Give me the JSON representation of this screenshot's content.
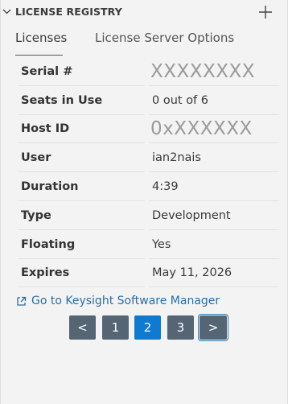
{
  "header": {
    "title": "LICENSE REGISTRY"
  },
  "tabs": [
    {
      "label": "Licenses",
      "active": true
    },
    {
      "label": "License Server Options",
      "active": false
    }
  ],
  "license": {
    "rows": [
      {
        "key": "Serial #",
        "value": "XXXXXXXX"
      },
      {
        "key": "Seats in Use",
        "value": "0 out of 6"
      },
      {
        "key": "Host ID",
        "value": "0xXXXXXX"
      },
      {
        "key": "User",
        "value": "ian2nais"
      },
      {
        "key": "Duration",
        "value": "4:39"
      },
      {
        "key": "Type",
        "value": "Development"
      },
      {
        "key": "Floating",
        "value": "Yes"
      },
      {
        "key": "Expires",
        "value": "May 11, 2026"
      }
    ]
  },
  "link": {
    "label": "Go to Keysight Software Manager"
  },
  "pagination": {
    "prev_label": "<",
    "next_label": ">",
    "pages": [
      "1",
      "2",
      "3"
    ],
    "current_page": "2"
  },
  "colors": {
    "accent": "#0e7ad0",
    "pager_button": "#566573",
    "link": "#2b6ea6"
  },
  "icons": {
    "collapse": "chevron-down-icon",
    "add": "plus-icon",
    "external_link": "external-link-icon"
  }
}
